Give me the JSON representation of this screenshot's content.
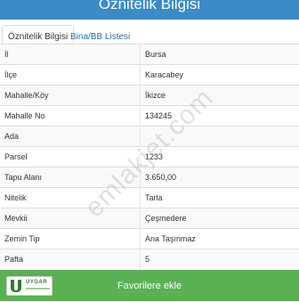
{
  "header": {
    "title": "Öznitelik Bilgisi"
  },
  "tabs": [
    {
      "label": "Öznitelik Bilgisi",
      "active": true
    },
    {
      "label": "Bina/BB Listesi",
      "active": false
    }
  ],
  "rows": [
    {
      "key": "İl",
      "value": "Bursa"
    },
    {
      "key": "İlçe",
      "value": "Karacabey"
    },
    {
      "key": "Mahalle/Köy",
      "value": "İkizce"
    },
    {
      "key": "Mahalle No",
      "value": "134245"
    },
    {
      "key": "Ada",
      "value": ""
    },
    {
      "key": "Parsel",
      "value": "1233"
    },
    {
      "key": "Tapu Alanı",
      "value": "3.650,00"
    },
    {
      "key": "Nitelik",
      "value": "Tarla"
    },
    {
      "key": "Mevkii",
      "value": "Çeşmedere"
    },
    {
      "key": "Zemin Tip",
      "value": "Ana Taşınmaz"
    },
    {
      "key": "Pafta",
      "value": "5"
    }
  ],
  "watermark": "emlakjet.com",
  "footer": {
    "button_label": "Favorilere ekle",
    "logo_text": "UYGAR"
  },
  "colors": {
    "header": "#3c8bc6",
    "footer": "#5ab154",
    "tab_link": "#2a6ea8"
  }
}
